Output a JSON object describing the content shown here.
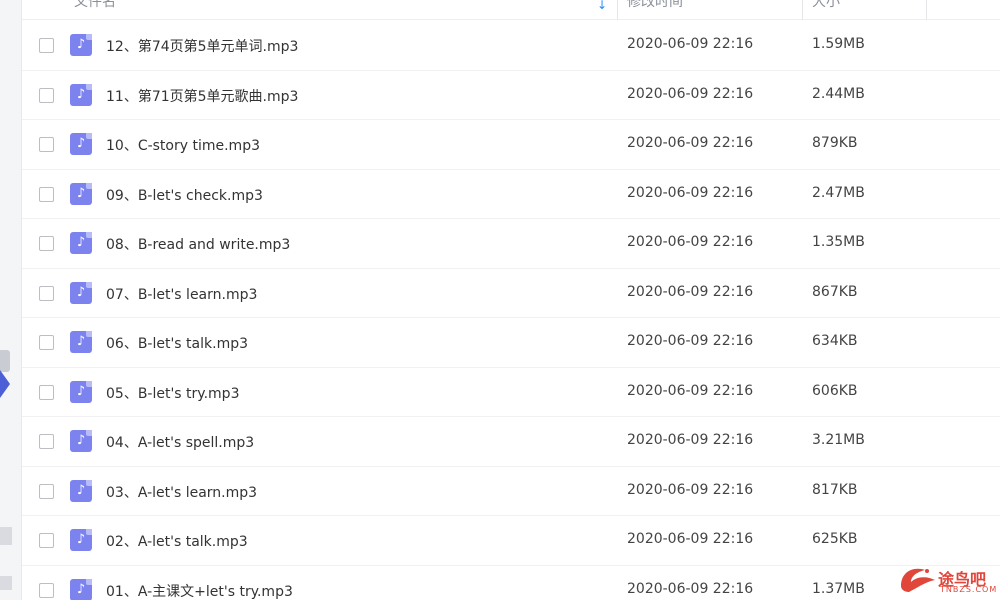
{
  "header": {
    "name_label": "文件名",
    "time_label": "修改时间",
    "size_label": "大小"
  },
  "files": [
    {
      "name": "12、第74页第5单元单词.mp3",
      "time": "2020-06-09 22:16",
      "size": "1.59MB"
    },
    {
      "name": "11、第71页第5单元歌曲.mp3",
      "time": "2020-06-09 22:16",
      "size": "2.44MB"
    },
    {
      "name": "10、C-story time.mp3",
      "time": "2020-06-09 22:16",
      "size": "879KB"
    },
    {
      "name": "09、B-let's check.mp3",
      "time": "2020-06-09 22:16",
      "size": "2.47MB"
    },
    {
      "name": "08、B-read and write.mp3",
      "time": "2020-06-09 22:16",
      "size": "1.35MB"
    },
    {
      "name": "07、B-let's learn.mp3",
      "time": "2020-06-09 22:16",
      "size": "867KB"
    },
    {
      "name": "06、B-let's talk.mp3",
      "time": "2020-06-09 22:16",
      "size": "634KB"
    },
    {
      "name": "05、B-let's try.mp3",
      "time": "2020-06-09 22:16",
      "size": "606KB"
    },
    {
      "name": "04、A-let's spell.mp3",
      "time": "2020-06-09 22:16",
      "size": "3.21MB"
    },
    {
      "name": "03、A-let's learn.mp3",
      "time": "2020-06-09 22:16",
      "size": "817KB"
    },
    {
      "name": "02、A-let's talk.mp3",
      "time": "2020-06-09 22:16",
      "size": "625KB"
    },
    {
      "name": "01、A-主课文+let's try.mp3",
      "time": "2020-06-09 22:16",
      "size": "1.37MB"
    }
  ],
  "icons": {
    "file": "music-file-icon",
    "sort": "sort-arrow-down-icon"
  },
  "colors": {
    "accent": "#1e8cff",
    "file_icon": "#7d83ee",
    "watermark": "#e0463a"
  },
  "watermark": {
    "text": "途鸟吧",
    "sub": "TNBZS.COM"
  }
}
